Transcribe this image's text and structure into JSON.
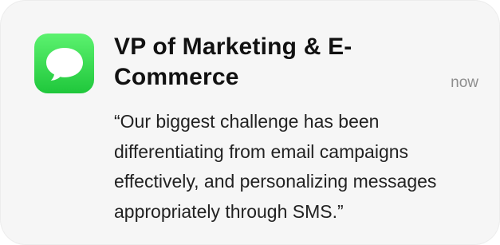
{
  "notification": {
    "app_icon": "messages-icon",
    "title": "VP of Marketing & E-Commerce",
    "time": "now",
    "message_lines": [
      "“Our biggest challenge has been",
      "differentiating from email campaigns",
      "effectively, and personalizing messages",
      "appropriately through SMS.”"
    ]
  },
  "colors": {
    "card_background": "#f6f6f6",
    "icon_green_top": "#5cf26f",
    "icon_green_bottom": "#1fc73b",
    "title_text": "#111111",
    "time_text": "#8e8e8e",
    "body_text": "#222222"
  }
}
